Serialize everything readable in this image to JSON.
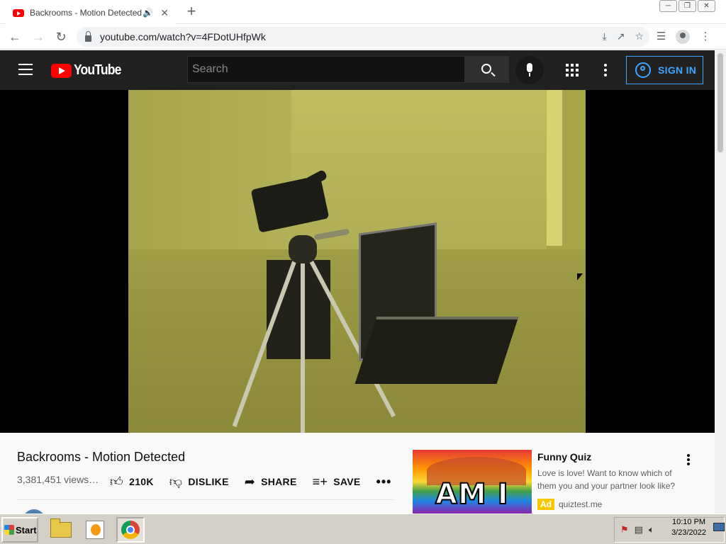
{
  "browser": {
    "tab_title": "Backrooms - Motion Detected",
    "audio_icon": "speaker-icon",
    "url": "youtube.com/watch?v=4FDotUHfpWk"
  },
  "youtube": {
    "logo_text": "YouTube",
    "search_placeholder": "Search",
    "sign_in_label": "SIGN IN",
    "accent_color": "#3ea6ff",
    "brand_color": "#ff0000"
  },
  "video": {
    "title": "Backrooms - Motion Detected",
    "views": "3,381,451 views…",
    "like_count": "210K",
    "dislike_label": "DISLIKE",
    "share_label": "SHARE",
    "save_label": "SAVE",
    "more_label": "•••"
  },
  "ad": {
    "thumb_text": "AM I",
    "title": "Funny Quiz",
    "description": "Love is love! Want to know which of them you and your partner look like?",
    "badge": "Ad",
    "domain": "quiztest.me"
  },
  "taskbar": {
    "start_label": "Start",
    "time": "10:10 PM",
    "date": "3/23/2022"
  }
}
